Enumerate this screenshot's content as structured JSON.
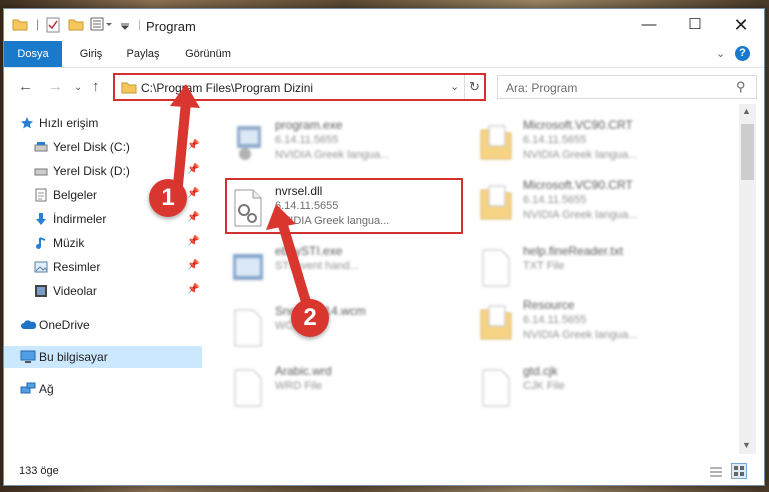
{
  "window": {
    "title": "Program"
  },
  "ribbon": {
    "tabs": [
      "Dosya",
      "Giriş",
      "Paylaş",
      "Görünüm"
    ]
  },
  "address": {
    "path": "C:\\Program Files\\Program Dizini",
    "search_placeholder": "Ara: Program"
  },
  "sidebar": {
    "items": [
      {
        "label": "Hızlı erişim",
        "icon": "star-icon"
      },
      {
        "label": "Yerel Disk (C:)",
        "icon": "drive-icon"
      },
      {
        "label": "Yerel Disk (D:)",
        "icon": "drive-icon"
      },
      {
        "label": "Belgeler",
        "icon": "documents-icon"
      },
      {
        "label": "İndirmeler",
        "icon": "downloads-icon"
      },
      {
        "label": "Müzik",
        "icon": "music-icon"
      },
      {
        "label": "Resimler",
        "icon": "pictures-icon"
      },
      {
        "label": "Videolar",
        "icon": "videos-icon"
      },
      {
        "label": "OneDrive",
        "icon": "cloud-icon"
      },
      {
        "label": "Bu bilgisayar",
        "icon": "computer-icon"
      },
      {
        "label": "Ağ",
        "icon": "network-icon"
      }
    ]
  },
  "files": [
    {
      "name": "program.exe",
      "line2": "6.14.11.5655",
      "line3": "NVIDIA Greek langua..."
    },
    {
      "name": "Microsoft.VC90.CRT",
      "line2": "6.14.11.5655",
      "line3": "NVIDIA Greek langua..."
    },
    {
      "name": "nvrsel.dll",
      "line2": "6.14.11.5655",
      "line3": "NVIDIA Greek langua..."
    },
    {
      "name": "Microsoft.VC90.CRT",
      "line2": "6.14.11.5655",
      "line3": "NVIDIA Greek langua..."
    },
    {
      "name": "ebbySTI.exe",
      "line2": "STI event hand...",
      "line3": ""
    },
    {
      "name": "help.fineReader.txt",
      "line2": "TXT File",
      "line3": ""
    },
    {
      "name": "Sno...MP14.wcm",
      "line2": "WC...",
      "line3": ""
    },
    {
      "name": "Resource",
      "line2": "6.14.11.5655",
      "line3": "NVIDIA Greek langua..."
    },
    {
      "name": "Arabic.wrd",
      "line2": "WRD File",
      "line3": ""
    },
    {
      "name": "gtd.cjk",
      "line2": "CJK File",
      "line3": ""
    }
  ],
  "status": {
    "count": "133 öge"
  },
  "callouts": [
    "1",
    "2"
  ],
  "colors": {
    "accent": "#1979ca",
    "highlight": "#d3312d",
    "selected": "#cce8ff"
  }
}
